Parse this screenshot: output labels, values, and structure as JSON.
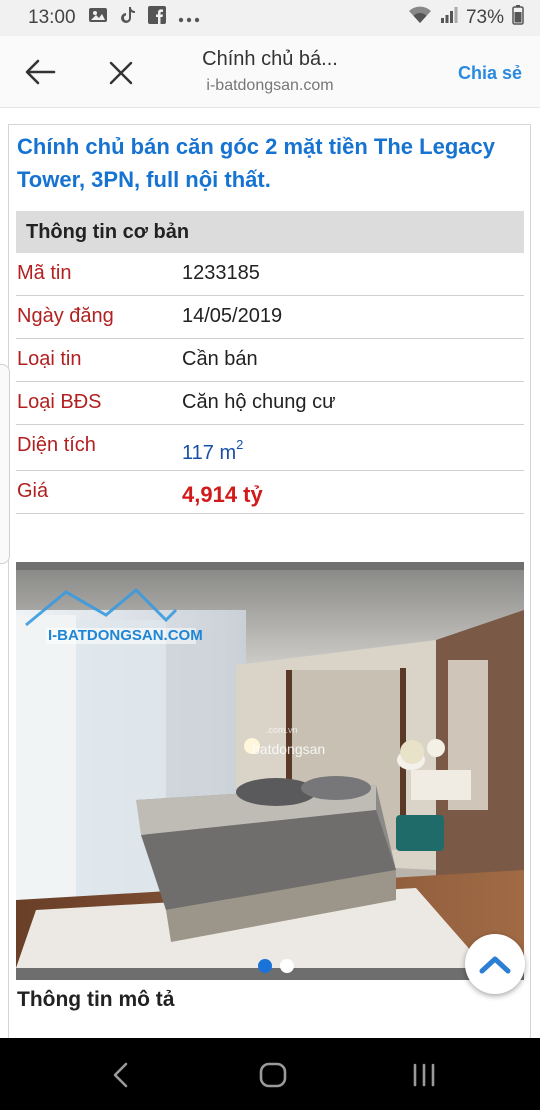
{
  "status": {
    "time": "13:00",
    "battery": "73%",
    "left_icons": [
      "gallery-icon",
      "tiktok-icon",
      "facebook-icon",
      "more-dots-icon"
    ],
    "right_icons": [
      "wifi-icon",
      "signal-icon",
      "battery-icon"
    ]
  },
  "browser": {
    "title": "Chính chủ bá...",
    "url": "i-batdongsan.com",
    "share_label": "Chia sẻ"
  },
  "listing": {
    "title": "Chính chủ bán căn góc 2 mặt tiền The Legacy Tower, 3PN, full nội thất.",
    "info_header": "Thông tin cơ bản",
    "rows": [
      {
        "label": "Mã tin",
        "value": "1233185"
      },
      {
        "label": "Ngày đăng",
        "value": "14/05/2019"
      },
      {
        "label": "Loại tin",
        "value": "Cần bán"
      },
      {
        "label": "Loại BĐS",
        "value": "Căn hộ chung cư"
      },
      {
        "label": "Diện tích",
        "value": "117 m",
        "unit_sup": "2"
      },
      {
        "label": "Giá",
        "value": "4,914 tỷ"
      }
    ]
  },
  "gallery": {
    "watermark": "I-BATDONGSAN.COM",
    "watermark_small": "batdongsan",
    "watermark_tiny": ".com.vn",
    "slide_count": 2,
    "active_slide": 1
  },
  "description": {
    "title": "Thông tin mô tả"
  },
  "colors": {
    "title_blue": "#1673d1",
    "label_red": "#b22020",
    "price_red": "#d31a1a",
    "area_blue": "#1a4fa8",
    "share_blue": "#2a8ae0"
  }
}
